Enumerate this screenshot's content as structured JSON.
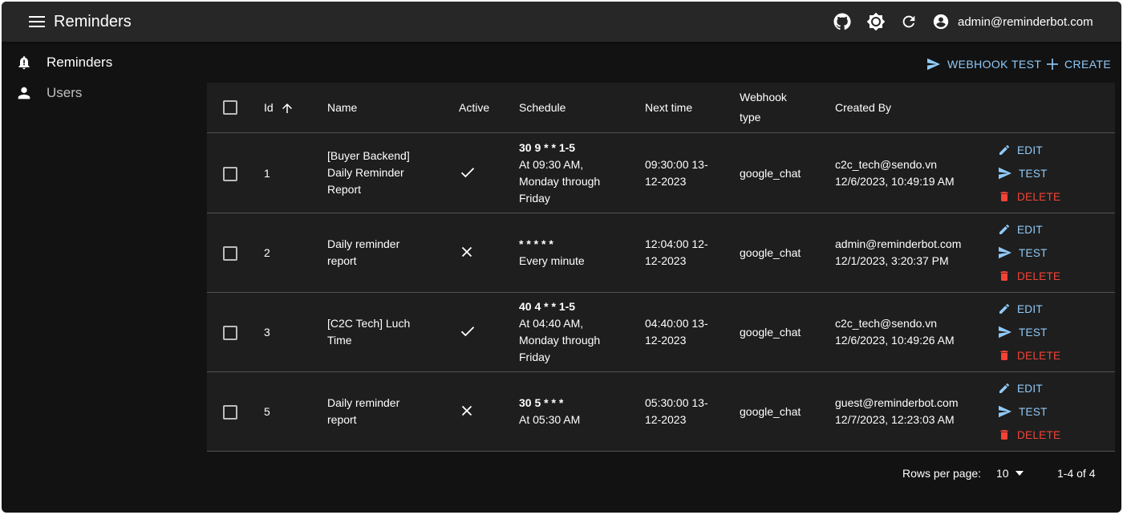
{
  "app": {
    "title": "Reminders"
  },
  "user": {
    "email": "admin@reminderbot.com"
  },
  "sidebar": {
    "items": [
      {
        "label": "Reminders",
        "icon": "bell-icon",
        "active": true
      },
      {
        "label": "Users",
        "icon": "person-icon",
        "active": false
      }
    ]
  },
  "toolbar": {
    "webhook_test_label": "WEBHOOK TEST",
    "create_label": "CREATE"
  },
  "table": {
    "headers": {
      "id": "Id",
      "name": "Name",
      "active": "Active",
      "schedule": "Schedule",
      "next_time": "Next time",
      "webhook_type_1": "Webhook",
      "webhook_type_2": "type",
      "created_by": "Created By"
    },
    "actions": {
      "edit": "EDIT",
      "test": "TEST",
      "delete": "DELETE"
    },
    "rows": [
      {
        "id": "1",
        "name": [
          "[Buyer Backend]",
          "Daily Reminder",
          "Report"
        ],
        "active": true,
        "cron": "30 9 * * 1-5",
        "schedule_desc": [
          "At 09:30 AM,",
          "Monday through",
          "Friday"
        ],
        "next_time": [
          "09:30:00 13-",
          "12-2023"
        ],
        "webhook_type": "google_chat",
        "created_by": "c2c_tech@sendo.vn",
        "created_at": "12/6/2023, 10:49:19 AM"
      },
      {
        "id": "2",
        "name": [
          "Daily reminder",
          "report"
        ],
        "active": false,
        "cron": "* * * * *",
        "schedule_desc": [
          "Every minute"
        ],
        "next_time": [
          "12:04:00 12-",
          "12-2023"
        ],
        "webhook_type": "google_chat",
        "created_by": "admin@reminderbot.com",
        "created_at": "12/1/2023, 3:20:37 PM"
      },
      {
        "id": "3",
        "name": [
          "[C2C Tech] Luch",
          "Time"
        ],
        "active": true,
        "cron": "40 4 * * 1-5",
        "schedule_desc": [
          "At 04:40 AM,",
          "Monday through",
          "Friday"
        ],
        "next_time": [
          "04:40:00 13-",
          "12-2023"
        ],
        "webhook_type": "google_chat",
        "created_by": "c2c_tech@sendo.vn",
        "created_at": "12/6/2023, 10:49:26 AM"
      },
      {
        "id": "5",
        "name": [
          "Daily reminder",
          "report"
        ],
        "active": false,
        "cron": "30 5 * * *",
        "schedule_desc": [
          "At 05:30 AM"
        ],
        "next_time": [
          "05:30:00 13-",
          "12-2023"
        ],
        "webhook_type": "google_chat",
        "created_by": "guest@reminderbot.com",
        "created_at": "12/7/2023, 12:23:03 AM"
      }
    ]
  },
  "pagination": {
    "rows_per_page_label": "Rows per page:",
    "rows_per_page": "10",
    "range": "1-4 of 4"
  },
  "colors": {
    "background": "#121212",
    "appbar": "#272727",
    "table": "#1e1e1e",
    "accent": "#90caf9",
    "danger": "#f44336"
  }
}
